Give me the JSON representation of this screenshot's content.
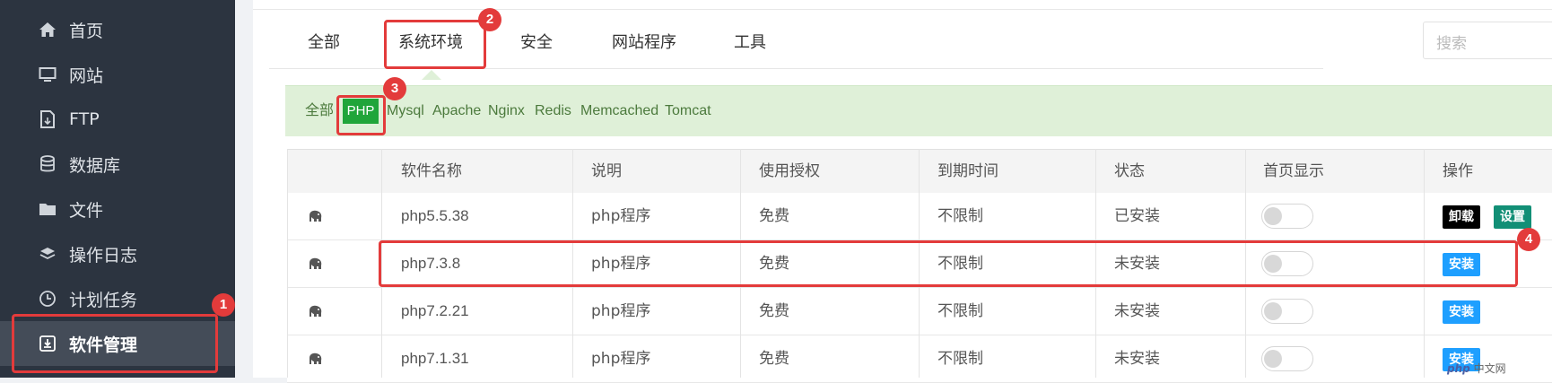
{
  "sidebar": {
    "items": [
      {
        "label": "首页",
        "icon": "home-icon"
      },
      {
        "label": "网站",
        "icon": "monitor-icon"
      },
      {
        "label": "FTP",
        "icon": "ftp-icon"
      },
      {
        "label": "数据库",
        "icon": "database-icon"
      },
      {
        "label": "文件",
        "icon": "folder-icon"
      },
      {
        "label": "操作日志",
        "icon": "layers-icon"
      },
      {
        "label": "计划任务",
        "icon": "clock-icon"
      },
      {
        "label": "软件管理",
        "icon": "download-box-icon",
        "active": true
      }
    ]
  },
  "tabs": [
    "全部",
    "系统环境",
    "安全",
    "网站程序",
    "工具"
  ],
  "active_tab": "系统环境",
  "search": {
    "placeholder": "搜索"
  },
  "filters": [
    "全部",
    "PHP",
    "Mysql",
    "Apache",
    "Nginx",
    "Redis",
    "Memcached",
    "Tomcat"
  ],
  "active_filter": "PHP",
  "table": {
    "headers": [
      "软件名称",
      "说明",
      "使用授权",
      "到期时间",
      "状态",
      "首页显示",
      "操作"
    ],
    "rows": [
      {
        "name": "php5.5.38",
        "desc": "php程序",
        "license": "免费",
        "expiry": "不限制",
        "status": "已安装",
        "actions": [
          "卸载",
          "设置"
        ]
      },
      {
        "name": "php7.3.8",
        "desc": "php程序",
        "license": "免费",
        "expiry": "不限制",
        "status": "未安装",
        "actions": [
          "安装"
        ]
      },
      {
        "name": "php7.2.21",
        "desc": "php程序",
        "license": "免费",
        "expiry": "不限制",
        "status": "未安装",
        "actions": [
          "安装"
        ]
      },
      {
        "name": "php7.1.31",
        "desc": "php程序",
        "license": "免费",
        "expiry": "不限制",
        "status": "未安装",
        "actions": [
          "安装"
        ]
      }
    ]
  },
  "annotations": [
    "1",
    "2",
    "3",
    "4"
  ],
  "watermark": {
    "brand": "php",
    "text": "中文网"
  },
  "colors": {
    "annotation": "#e33b3b",
    "filter_active": "#20a53a",
    "install_button": "#1e9fff",
    "settings_button": "#128f76",
    "uninstall_button": "#000000"
  }
}
